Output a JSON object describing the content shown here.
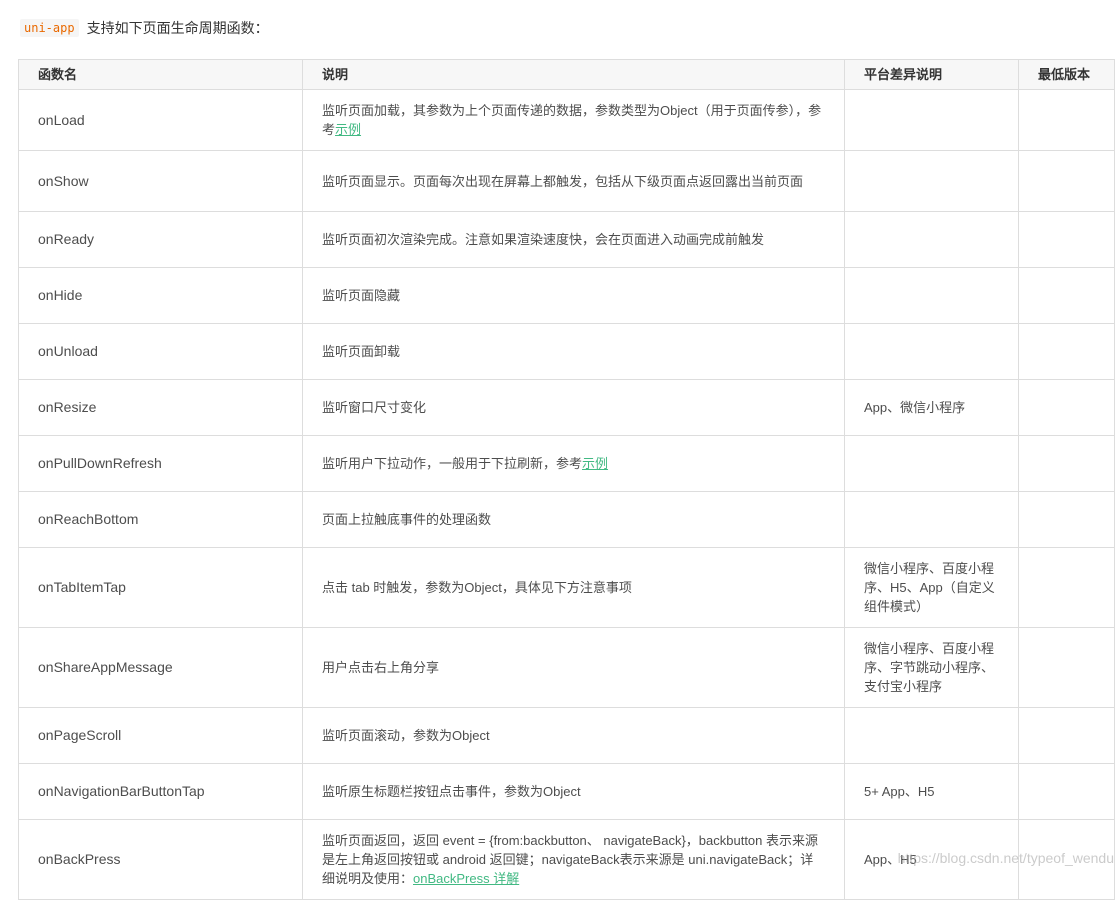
{
  "intro": {
    "code": "uni-app",
    "text": "支持如下页面生命周期函数："
  },
  "table": {
    "headers": [
      "函数名",
      "说明",
      "平台差异说明",
      "最低版本"
    ],
    "rows": [
      {
        "name": "onLoad",
        "desc": "监听页面加载，其参数为上个页面传递的数据，参数类型为Object（用于页面传参），参考",
        "link": "示例",
        "platform": "",
        "version": ""
      },
      {
        "name": "onShow",
        "desc": "监听页面显示。页面每次出现在屏幕上都触发，包括从下级页面点返回露出当前页面",
        "platform": "",
        "version": ""
      },
      {
        "name": "onReady",
        "desc": "监听页面初次渲染完成。注意如果渲染速度快，会在页面进入动画完成前触发",
        "platform": "",
        "version": ""
      },
      {
        "name": "onHide",
        "desc": "监听页面隐藏",
        "platform": "",
        "version": ""
      },
      {
        "name": "onUnload",
        "desc": "监听页面卸载",
        "platform": "",
        "version": ""
      },
      {
        "name": "onResize",
        "desc": "监听窗口尺寸变化",
        "platform": "App、微信小程序",
        "version": ""
      },
      {
        "name": "onPullDownRefresh",
        "desc": "监听用户下拉动作，一般用于下拉刷新，参考",
        "link": "示例",
        "platform": "",
        "version": ""
      },
      {
        "name": "onReachBottom",
        "desc": "页面上拉触底事件的处理函数",
        "platform": "",
        "version": ""
      },
      {
        "name": "onTabItemTap",
        "desc": "点击 tab 时触发，参数为Object，具体见下方注意事项",
        "platform": "微信小程序、百度小程序、H5、App（自定义组件模式）",
        "version": ""
      },
      {
        "name": "onShareAppMessage",
        "desc": "用户点击右上角分享",
        "platform": "微信小程序、百度小程序、字节跳动小程序、支付宝小程序",
        "version": ""
      },
      {
        "name": "onPageScroll",
        "desc": "监听页面滚动，参数为Object",
        "platform": "",
        "version": ""
      },
      {
        "name": "onNavigationBarButtonTap",
        "desc": "监听原生标题栏按钮点击事件，参数为Object",
        "platform": "5+ App、H5",
        "version": ""
      },
      {
        "name": "onBackPress",
        "desc": "监听页面返回，返回 event = {from:backbutton、 navigateBack}，backbutton 表示来源是左上角返回按钮或 android 返回键；navigateBack表示来源是 uni.navigateBack；详细说明及使用：",
        "link": "onBackPress 详解",
        "platform": "App、H5",
        "version": ""
      }
    ]
  },
  "watermark": "https://blog.csdn.net/typeof_wendu"
}
